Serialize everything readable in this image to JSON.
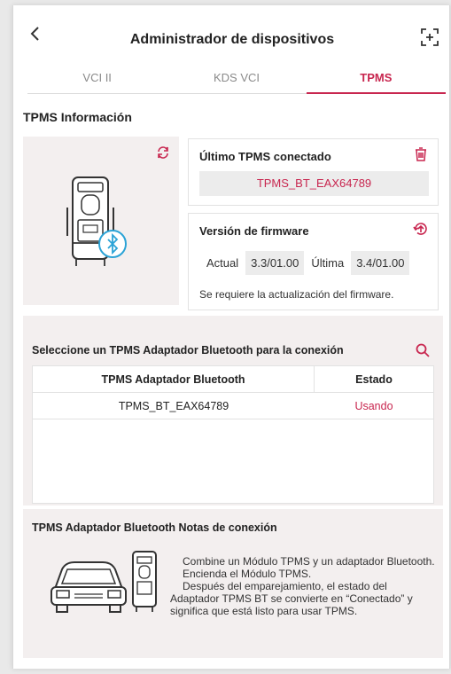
{
  "header": {
    "title": "Administrador de dispositivos"
  },
  "tabs": [
    {
      "label": "VCI II",
      "active": false
    },
    {
      "label": "KDS VCI",
      "active": false
    },
    {
      "label": "TPMS",
      "active": true
    }
  ],
  "info": {
    "section_title": "TPMS Información",
    "last_tpms": {
      "title": "Último TPMS conectado",
      "name": "TPMS_BT_EAX64789"
    },
    "firmware": {
      "title": "Versión de firmware",
      "current_label": "Actual",
      "current_value": "3.3/01.00",
      "latest_label": "Última",
      "latest_value": "3.4/01.00",
      "note": "Se requiere la actualización del firmware."
    }
  },
  "bluetooth": {
    "title": "Seleccione un TPMS Adaptador Bluetooth para la conexión",
    "table": {
      "headers": [
        "TPMS Adaptador Bluetooth",
        "Estado"
      ],
      "rows": [
        {
          "name": "TPMS_BT_EAX64789",
          "status": "Usando"
        }
      ]
    }
  },
  "notes": {
    "title": "TPMS Adaptador Bluetooth Notas de conexión",
    "lines": [
      "Combine un Módulo TPMS y un adaptador Bluetooth.",
      "Encienda el Módulo TPMS.",
      "Después del emparejamiento, el estado del Adaptador TPMS BT se convierte en “Conectado” y significa que está listo para usar TPMS."
    ]
  },
  "colors": {
    "accent": "#c8264f",
    "panel_bg": "#f3efef",
    "field_bg": "#ececec"
  },
  "icons": {
    "back": "chevron-left-icon",
    "add": "scan-add-icon",
    "refresh": "refresh-icon",
    "delete": "trash-icon",
    "update": "firmware-update-icon",
    "search": "search-icon",
    "bluetooth": "bluetooth-icon"
  }
}
